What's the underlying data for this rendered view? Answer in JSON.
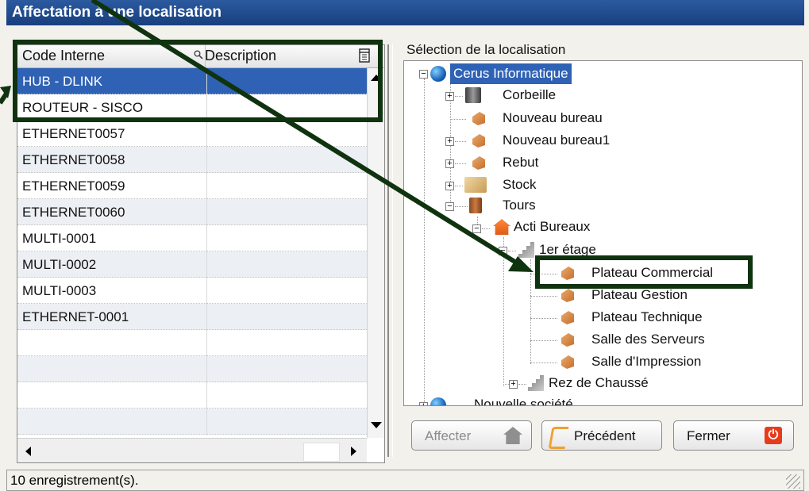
{
  "window": {
    "title": "Affectation à une localisation"
  },
  "grid": {
    "columns": {
      "code": "Code Interne",
      "description": "Description"
    },
    "rows": [
      {
        "code": "HUB - DLINK",
        "description": ""
      },
      {
        "code": "ROUTEUR - SISCO",
        "description": ""
      },
      {
        "code": "ETHERNET0057",
        "description": ""
      },
      {
        "code": "ETHERNET0058",
        "description": ""
      },
      {
        "code": "ETHERNET0059",
        "description": ""
      },
      {
        "code": "ETHERNET0060",
        "description": ""
      },
      {
        "code": "MULTI-0001",
        "description": ""
      },
      {
        "code": "MULTI-0002",
        "description": ""
      },
      {
        "code": "MULTI-0003",
        "description": ""
      },
      {
        "code": "ETHERNET-0001",
        "description": ""
      }
    ],
    "selected_row": "HUB - DLINK"
  },
  "tree": {
    "label": "Sélection de la localisation",
    "nodes": {
      "cerus": "Cerus Informatique",
      "corbeille": "Corbeille",
      "nouveau_bureau": "Nouveau bureau",
      "nouveau_bureau1": "Nouveau bureau1",
      "rebut": "Rebut",
      "stock": "Stock",
      "tours": "Tours",
      "acti": "Acti  Bureaux",
      "etage": "1er étage",
      "plateau_commercial": "Plateau Commercial",
      "plateau_gestion": "Plateau Gestion",
      "plateau_technique": "Plateau Technique",
      "salle_serveurs": "Salle des Serveurs",
      "salle_impression": "Salle d'Impression",
      "rez": "Rez de Chaussé",
      "nouvelle_societe": "Nouvelle société"
    },
    "selected_node": "Cerus Informatique"
  },
  "buttons": {
    "affecter": "Affecter",
    "precedent": "Précédent",
    "fermer": "Fermer"
  },
  "status": {
    "text": "10 enregistrement(s)."
  },
  "colors": {
    "accent": "#2f62b4",
    "highlight": "#10330f",
    "close": "#e83b1c"
  }
}
